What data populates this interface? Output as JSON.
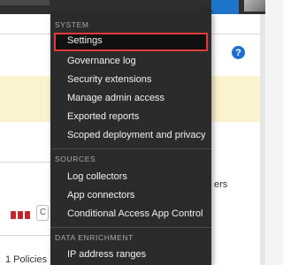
{
  "background": {
    "help_glyph": "?",
    "partial_text": "ers",
    "policies_label": "1 Policies",
    "small_box_text": "C"
  },
  "menu": {
    "sections": [
      {
        "header": "SYSTEM",
        "items": [
          {
            "label": "Settings",
            "selected": true
          },
          {
            "label": "Governance log"
          },
          {
            "label": "Security extensions"
          },
          {
            "label": "Manage admin access"
          },
          {
            "label": "Exported reports"
          },
          {
            "label": "Scoped deployment and privacy"
          }
        ]
      },
      {
        "header": "SOURCES",
        "items": [
          {
            "label": "Log collectors"
          },
          {
            "label": "App connectors"
          },
          {
            "label": "Conditional Access App Control"
          }
        ]
      },
      {
        "header": "DATA ENRICHMENT",
        "items": [
          {
            "label": "IP address ranges"
          }
        ]
      }
    ]
  },
  "colors": {
    "menu_bg": "#2b2b2b",
    "selection_border": "#e23a3a",
    "accent_blue": "#1e74c8"
  }
}
